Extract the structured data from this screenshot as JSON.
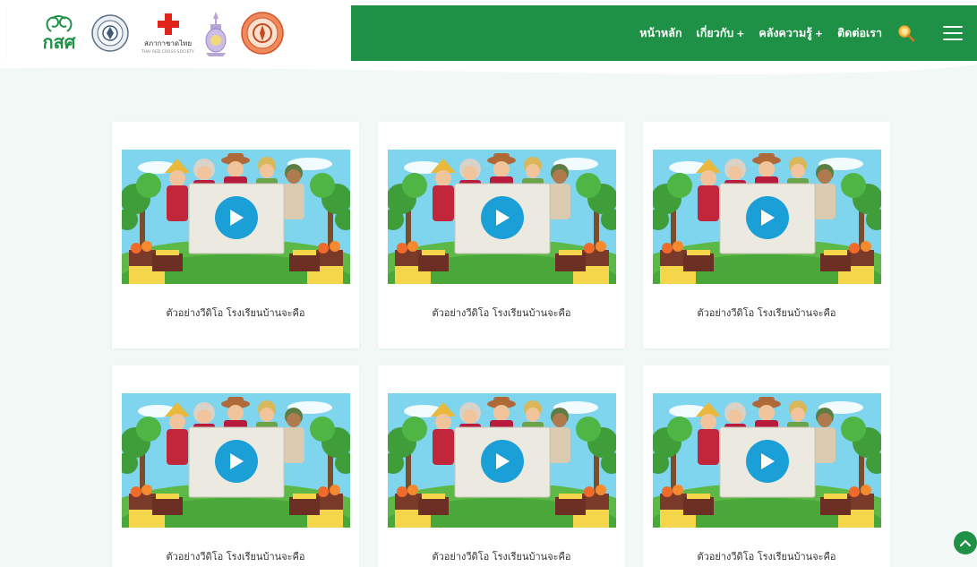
{
  "header": {
    "brand_logo_text": "กสศ",
    "redcross_name": "สภากาชาดไทย",
    "redcross_sub": "THAI RED CROSS SOCIETY",
    "nav_bg_color": "#1e9146",
    "nav": [
      {
        "label": "หน้าหลัก",
        "has_submenu": false
      },
      {
        "label": "เกี่ยวกับ",
        "has_submenu": true
      },
      {
        "label": "คลังความรู้",
        "has_submenu": true
      },
      {
        "label": "ติดต่อเรา",
        "has_submenu": false
      }
    ],
    "submenu_marker": "+",
    "icons": {
      "search": "search-icon",
      "menu": "hamburger-menu-icon"
    }
  },
  "videos": [
    {
      "title": "ตัวอย่างวีดิโอ โรงเรียนบ้านจะคือ",
      "thumbnail": "farmers-with-board-illustration",
      "play_icon": "play-icon"
    },
    {
      "title": "ตัวอย่างวีดิโอ โรงเรียนบ้านจะคือ",
      "thumbnail": "farmers-with-board-illustration",
      "play_icon": "play-icon"
    },
    {
      "title": "ตัวอย่างวีดิโอ โรงเรียนบ้านจะคือ",
      "thumbnail": "farmers-with-board-illustration",
      "play_icon": "play-icon"
    },
    {
      "title": "ตัวอย่างวีดิโอ โรงเรียนบ้านจะคือ",
      "thumbnail": "farmers-with-board-illustration",
      "play_icon": "play-icon"
    },
    {
      "title": "ตัวอย่างวีดิโอ โรงเรียนบ้านจะคือ",
      "thumbnail": "farmers-with-board-illustration",
      "play_icon": "play-icon"
    },
    {
      "title": "ตัวอย่างวีดิโอ โรงเรียนบ้านจะคือ",
      "thumbnail": "farmers-with-board-illustration",
      "play_icon": "play-icon"
    }
  ],
  "colors": {
    "accent": "#1e9146",
    "page_bg": "#f1f8f5",
    "play_button": "#1a9fd6"
  },
  "scroll_top_icon": "chevron-up-icon"
}
